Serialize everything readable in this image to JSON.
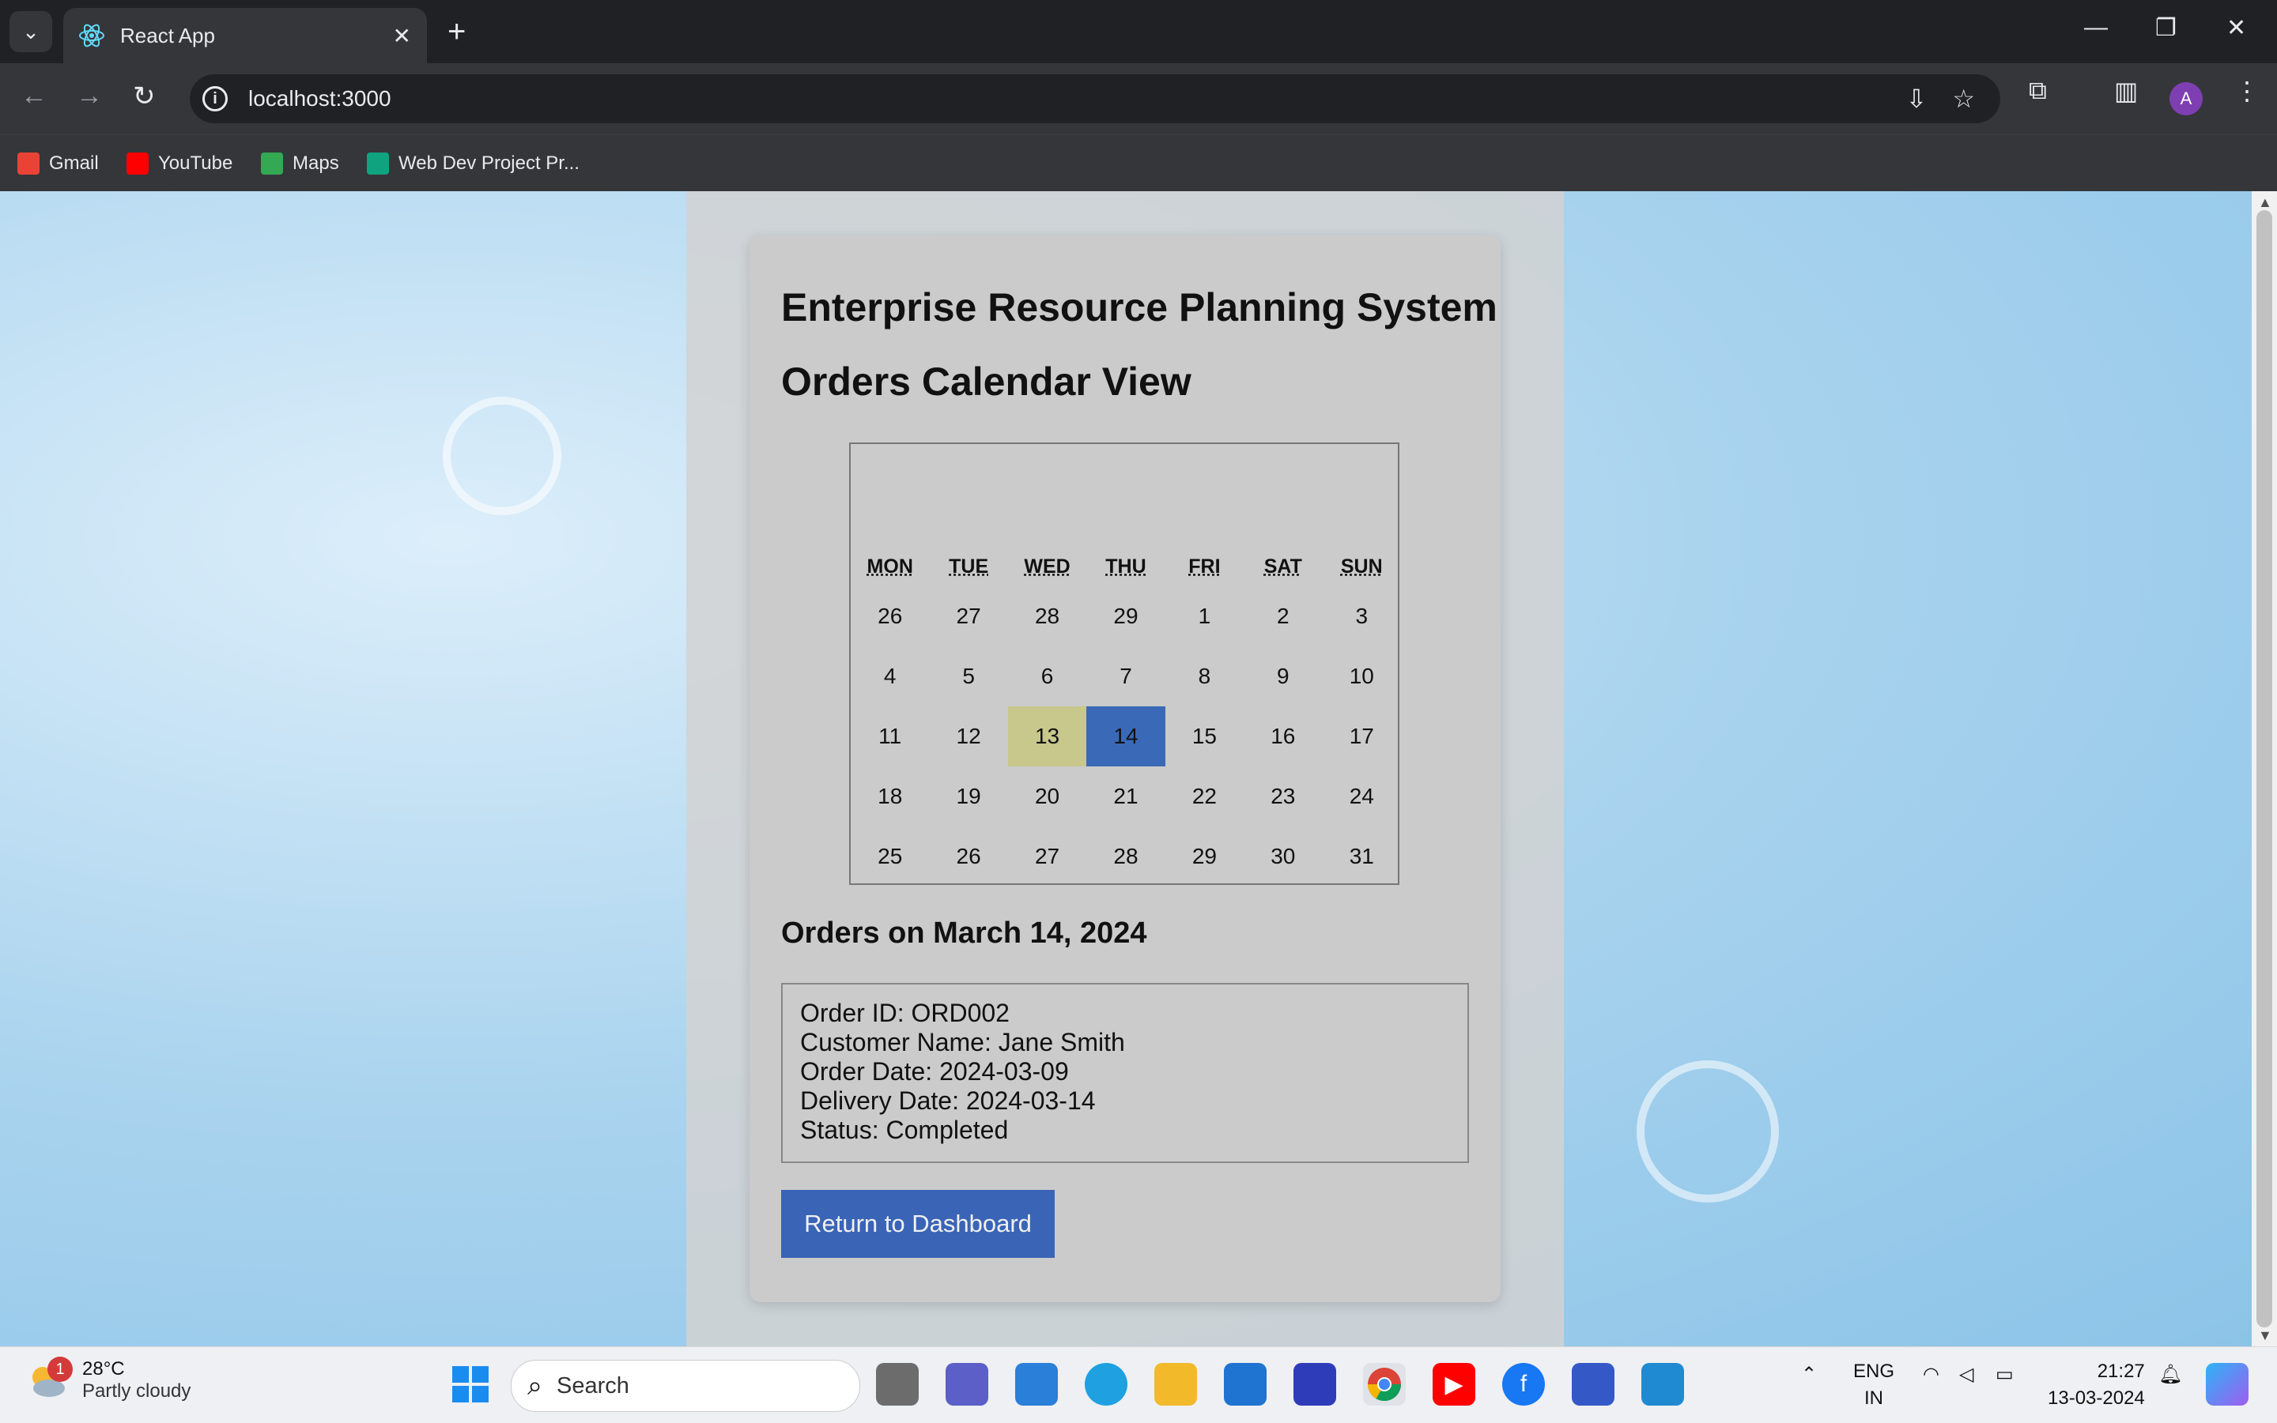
{
  "browser": {
    "tab_title": "React App",
    "url": "localhost:3000",
    "bookmarks": [
      {
        "label": "Gmail",
        "icon": "gmail-icon",
        "color": "#ea4335"
      },
      {
        "label": "YouTube",
        "icon": "youtube-icon",
        "color": "#ff0000"
      },
      {
        "label": "Maps",
        "icon": "maps-icon",
        "color": "#34a853"
      },
      {
        "label": "Web Dev Project Pr...",
        "icon": "chatgpt-icon",
        "color": "#10a37f"
      }
    ],
    "profile_initial": "A"
  },
  "app": {
    "title": "Enterprise Resource Planning System",
    "subtitle": "Orders Calendar View",
    "calendar": {
      "weekdays": [
        "MON",
        "TUE",
        "WED",
        "THU",
        "FRI",
        "SAT",
        "SUN"
      ],
      "weeks": [
        [
          "26",
          "27",
          "28",
          "29",
          "1",
          "2",
          "3"
        ],
        [
          "4",
          "5",
          "6",
          "7",
          "8",
          "9",
          "10"
        ],
        [
          "11",
          "12",
          "13",
          "14",
          "15",
          "16",
          "17"
        ],
        [
          "18",
          "19",
          "20",
          "21",
          "22",
          "23",
          "24"
        ],
        [
          "25",
          "26",
          "27",
          "28",
          "29",
          "30",
          "31"
        ]
      ],
      "today": "13",
      "selected": "14",
      "today_color": "#c8c78c",
      "selected_color": "#3a6ab7"
    },
    "orders_heading": "Orders on March 14, 2024",
    "order": {
      "id_line": "Order ID: ORD002",
      "customer_line": "Customer Name: Jane Smith",
      "order_date_line": "Order Date: 2024-03-09",
      "delivery_date_line": "Delivery Date: 2024-03-14",
      "status_line": "Status: Completed"
    },
    "return_button": "Return to Dashboard"
  },
  "taskbar": {
    "weather_temp": "28°C",
    "weather_cond": "Partly cloudy",
    "weather_badge": "1",
    "search_label": "Search",
    "lang_top": "ENG",
    "lang_bottom": "IN",
    "time": "21:27",
    "date": "13-03-2024"
  }
}
